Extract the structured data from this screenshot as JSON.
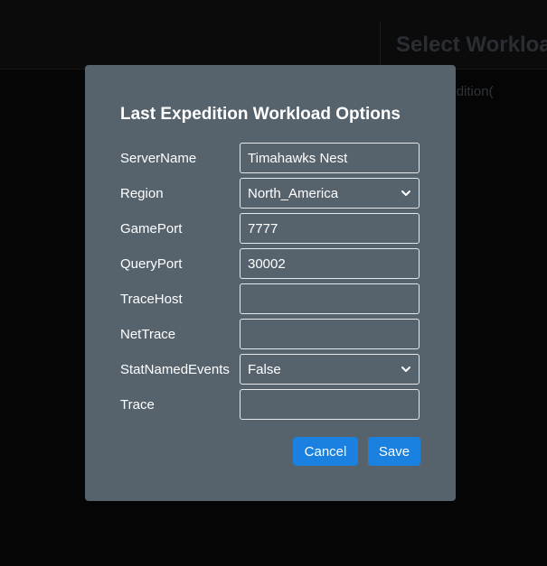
{
  "background": {
    "title": "Select Workload",
    "subtitle": "Last Expedition("
  },
  "modal": {
    "title": "Last Expedition Workload Options",
    "fields": [
      {
        "label": "ServerName",
        "type": "input",
        "value": "Timahawks Nest"
      },
      {
        "label": "Region",
        "type": "select",
        "value": "North_America"
      },
      {
        "label": "GamePort",
        "type": "input",
        "value": "7777"
      },
      {
        "label": "QueryPort",
        "type": "input",
        "value": "30002"
      },
      {
        "label": "TraceHost",
        "type": "input",
        "value": ""
      },
      {
        "label": "NetTrace",
        "type": "input",
        "value": ""
      },
      {
        "label": "StatNamedEvents",
        "type": "select",
        "value": "False"
      },
      {
        "label": "Trace",
        "type": "input",
        "value": ""
      }
    ],
    "cancel_label": "Cancel",
    "save_label": "Save"
  },
  "colors": {
    "modal_bg": "#56636d",
    "accent": "#1a81e0",
    "page_bg": "#050505"
  },
  "icons": {
    "select_arrow": "chevron-down-icon"
  }
}
